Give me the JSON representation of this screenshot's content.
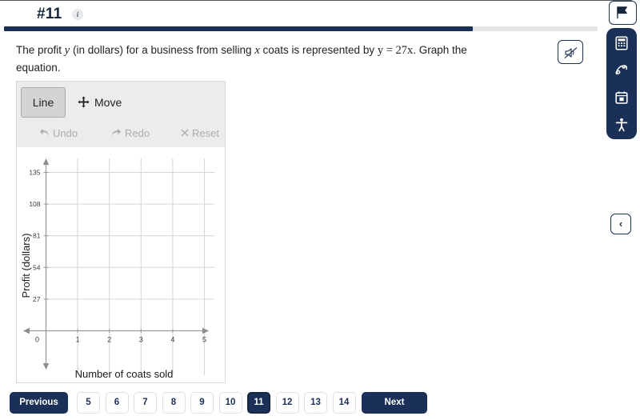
{
  "header": {
    "question_number": "#11",
    "info_icon": "info-icon",
    "progress_percent": 79
  },
  "question": {
    "part1": "The profit ",
    "var_y": "y",
    "part2": " (in dollars) for a business from selling ",
    "var_x": "x",
    "part3": " coats is represented by ",
    "equation": "y = 27x",
    "part4": ". Graph the equation."
  },
  "audio": {
    "mute_icon": "speaker-muted-icon"
  },
  "graph_widget": {
    "tools": {
      "line_label": "Line",
      "move_label": "Move",
      "move_icon": "move-arrows-icon",
      "undo_label": "Undo",
      "undo_icon": "undo-arrow-icon",
      "redo_label": "Redo",
      "redo_icon": "redo-arrow-icon",
      "reset_label": "Reset",
      "reset_icon": "close-x-icon"
    }
  },
  "chart_data": {
    "type": "line",
    "title": "",
    "xlabel": "Number of coats sold",
    "ylabel": "Profit (dollars)",
    "x_ticks": [
      "0",
      "1",
      "2",
      "3",
      "4",
      "5"
    ],
    "y_ticks": [
      "27",
      "54",
      "81",
      "108",
      "135"
    ],
    "xlim": [
      0,
      5
    ],
    "ylim": [
      0,
      148.5
    ],
    "grid": true,
    "legend": "none",
    "series": [
      {
        "name": "student-line",
        "values": []
      }
    ],
    "axis_arrows": true,
    "origin_label": "0"
  },
  "right_rail": {
    "flag_icon": "flag-icon",
    "items": [
      {
        "icon": "calculator-icon",
        "name": "calculator"
      },
      {
        "icon": "scribble-icon",
        "name": "scratchpad"
      },
      {
        "icon": "notepad-icon",
        "name": "notes"
      },
      {
        "icon": "accessibility-icon",
        "name": "accessibility"
      }
    ],
    "collapse_icon": "‹"
  },
  "pagination": {
    "previous_label": "Previous",
    "next_label": "Next",
    "pages": [
      "5",
      "6",
      "7",
      "8",
      "9",
      "10",
      "11",
      "12",
      "13",
      "14"
    ],
    "active_page": "11"
  },
  "colors": {
    "navy": "#1b3057",
    "toolbar_gray": "#ececec",
    "disabled_gray": "#adadad"
  }
}
